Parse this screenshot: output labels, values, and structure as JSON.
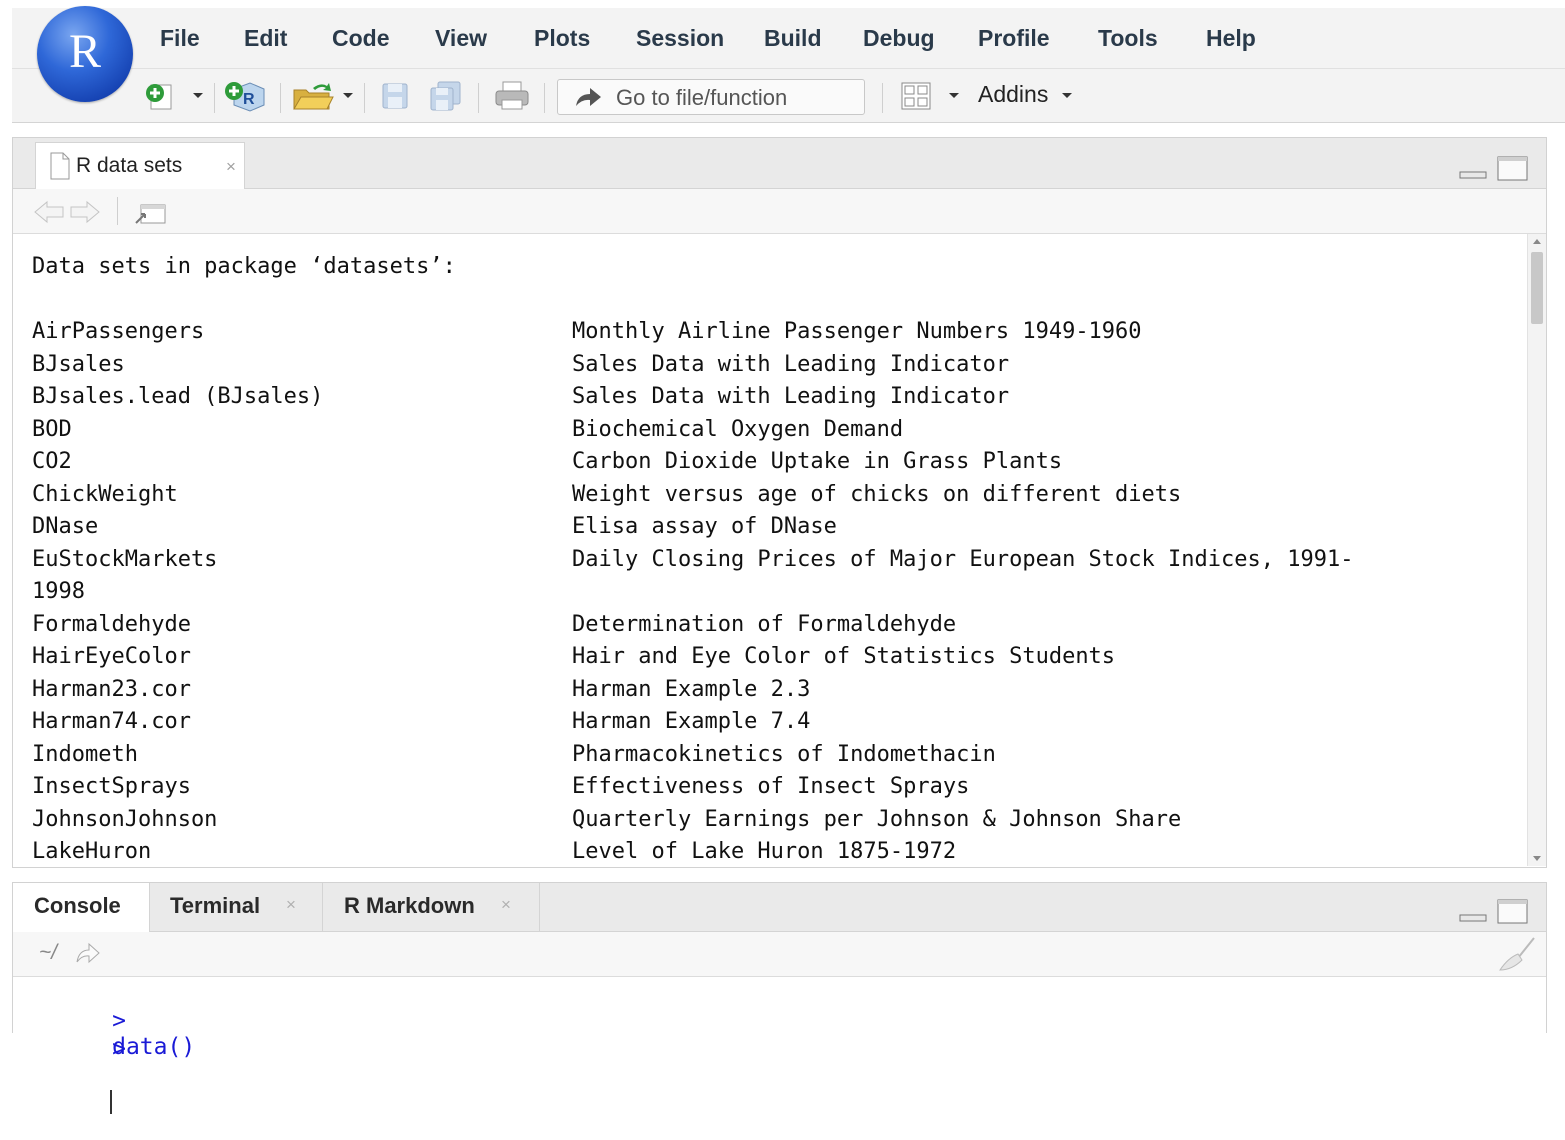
{
  "app": {
    "logo_letter": "R",
    "menus": [
      "File",
      "Edit",
      "Code",
      "View",
      "Plots",
      "Session",
      "Build",
      "Debug",
      "Profile",
      "Tools",
      "Help"
    ],
    "toolbar": {
      "goto_placeholder": "Go to file/function",
      "addins_label": "Addins"
    }
  },
  "source_pane": {
    "tab_label": "R data sets",
    "tab_close": "×",
    "heading": "Data sets in package ‘datasets’:",
    "datasets": [
      {
        "name": "AirPassengers",
        "desc": "Monthly Airline Passenger Numbers 1949-1960"
      },
      {
        "name": "BJsales",
        "desc": "Sales Data with Leading Indicator"
      },
      {
        "name": "BJsales.lead (BJsales)",
        "desc": "Sales Data with Leading Indicator"
      },
      {
        "name": "BOD",
        "desc": "Biochemical Oxygen Demand"
      },
      {
        "name": "CO2",
        "desc": "Carbon Dioxide Uptake in Grass Plants"
      },
      {
        "name": "ChickWeight",
        "desc": "Weight versus age of chicks on different diets"
      },
      {
        "name": "DNase",
        "desc": "Elisa assay of DNase"
      },
      {
        "name": "EuStockMarkets",
        "desc": "Daily Closing Prices of Major European Stock Indices, 1991-"
      },
      {
        "name": "1998",
        "desc": ""
      },
      {
        "name": "Formaldehyde",
        "desc": "Determination of Formaldehyde"
      },
      {
        "name": "HairEyeColor",
        "desc": "Hair and Eye Color of Statistics Students"
      },
      {
        "name": "Harman23.cor",
        "desc": "Harman Example 2.3"
      },
      {
        "name": "Harman74.cor",
        "desc": "Harman Example 7.4"
      },
      {
        "name": "Indometh",
        "desc": "Pharmacokinetics of Indomethacin"
      },
      {
        "name": "InsectSprays",
        "desc": "Effectiveness of Insect Sprays"
      },
      {
        "name": "JohnsonJohnson",
        "desc": "Quarterly Earnings per Johnson & Johnson Share"
      },
      {
        "name": "LakeHuron",
        "desc": "Level of Lake Huron 1875-1972"
      }
    ]
  },
  "console_pane": {
    "tabs": [
      {
        "label": "Console",
        "close": ""
      },
      {
        "label": "Terminal",
        "close": "×"
      },
      {
        "label": "R Markdown",
        "close": "×"
      }
    ],
    "path": "~/",
    "lines": [
      {
        "prompt": ">",
        "text": "data()"
      },
      {
        "prompt": ">",
        "text": ""
      }
    ]
  },
  "colors": {
    "accent": "#2f68d8",
    "console_text": "#1a1ad6"
  }
}
